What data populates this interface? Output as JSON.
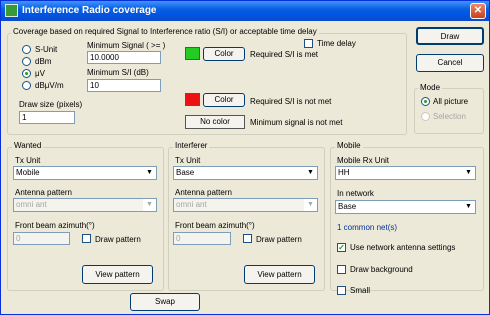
{
  "window": {
    "title": "Interference Radio coverage",
    "close_glyph": "✕"
  },
  "coverage": {
    "caption": "Coverage based on  required Signal to Interference ratio (S/I) or acceptable time delay",
    "units": [
      {
        "label": "S-Unit",
        "checked": false
      },
      {
        "label": "dBm",
        "checked": false
      },
      {
        "label": "μV",
        "checked": true
      },
      {
        "label": "dBμV/m",
        "checked": false
      }
    ],
    "min_signal_label": "Minimum Signal ( >= )",
    "min_signal_value": "10.0000",
    "min_si_label": "Minimum S/I (dB)",
    "min_si_value": "10",
    "draw_size_label": "Draw size (pixels)",
    "draw_size_value": "1",
    "time_delay_label": "Time delay",
    "met_color": "#22cc22",
    "notmet_color": "#ee1111",
    "color_button_label": "Color",
    "met_text": "Required S/I is met",
    "notmet_text": "Required S/I is not met",
    "no_color_label": "No color",
    "min_signal_not_met_text": "Minimum signal is not met"
  },
  "buttons": {
    "draw": "Draw",
    "cancel": "Cancel",
    "swap": "Swap"
  },
  "mode": {
    "caption": "Mode",
    "all_picture": "All picture",
    "selection": "Selection"
  },
  "wanted": {
    "caption": "Wanted",
    "tx_label": "Tx Unit",
    "tx_value": "Mobile",
    "antenna_label": "Antenna pattern",
    "antenna_value": "omni ant",
    "azimuth_label": "Front beam azimuth(°)",
    "azimuth_value": "0",
    "draw_pattern": "Draw pattern",
    "view_pattern": "View pattern"
  },
  "interferer": {
    "caption": "Interferer",
    "tx_label": "Tx Unit",
    "tx_value": "Base",
    "antenna_label": "Antenna pattern",
    "antenna_value": "omni ant",
    "azimuth_label": "Front beam azimuth(°)",
    "azimuth_value": "0",
    "draw_pattern": "Draw pattern",
    "view_pattern": "View pattern"
  },
  "mobile": {
    "caption": "Mobile",
    "rx_label": "Mobile Rx Unit",
    "rx_value": "HH",
    "network_label": "In network",
    "network_value": "Base",
    "common_text": "1 common net(s)",
    "use_network_antenna": "Use network antenna settings",
    "draw_background": "Draw background",
    "small": "Small"
  },
  "icons": {
    "dropdown": "▼",
    "check": "✓"
  }
}
